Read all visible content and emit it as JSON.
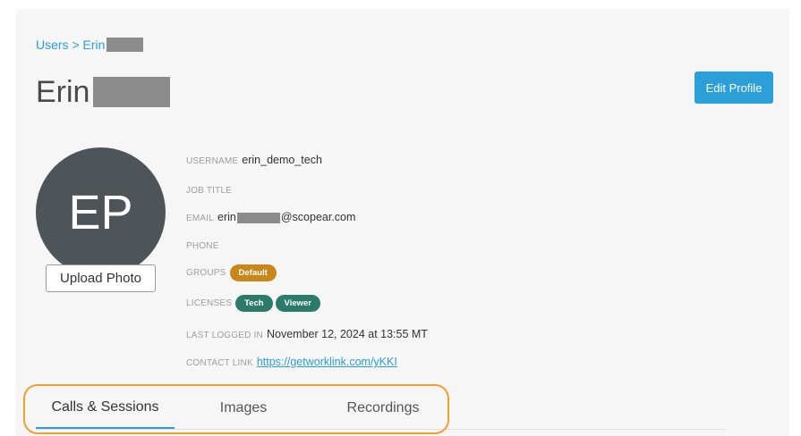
{
  "breadcrumb": {
    "text": "Users > Erin"
  },
  "page_title": "Erin",
  "edit_profile_label": "Edit Profile",
  "avatar": {
    "initials": "EP"
  },
  "upload_photo_label": "Upload Photo",
  "profile": {
    "username_label": "USERNAME",
    "username": "erin_demo_tech",
    "job_title_label": "JOB TITLE",
    "email_label": "EMAIL",
    "email_prefix": "erin",
    "email_suffix": "@scopear.com",
    "phone_label": "PHONE",
    "groups_label": "GROUPS",
    "groups": [
      "Default"
    ],
    "licenses_label": "LICENSES",
    "licenses": [
      "Tech",
      "Viewer"
    ],
    "last_logged_label": "LAST LOGGED IN",
    "last_logged": "November 12, 2024 at 13:55 MT",
    "contact_link_label": "CONTACT LINK",
    "contact_link": "https://getworklink.com/yKKI"
  },
  "tabs": [
    {
      "label": "Calls & Sessions",
      "active": true
    },
    {
      "label": "Images",
      "active": false
    },
    {
      "label": "Recordings",
      "active": false
    }
  ],
  "colors": {
    "accent": "#2a9fd8",
    "group_badge": "#c8871a",
    "license_badge": "#2b7a6a",
    "highlight_outline": "#f0a030"
  }
}
